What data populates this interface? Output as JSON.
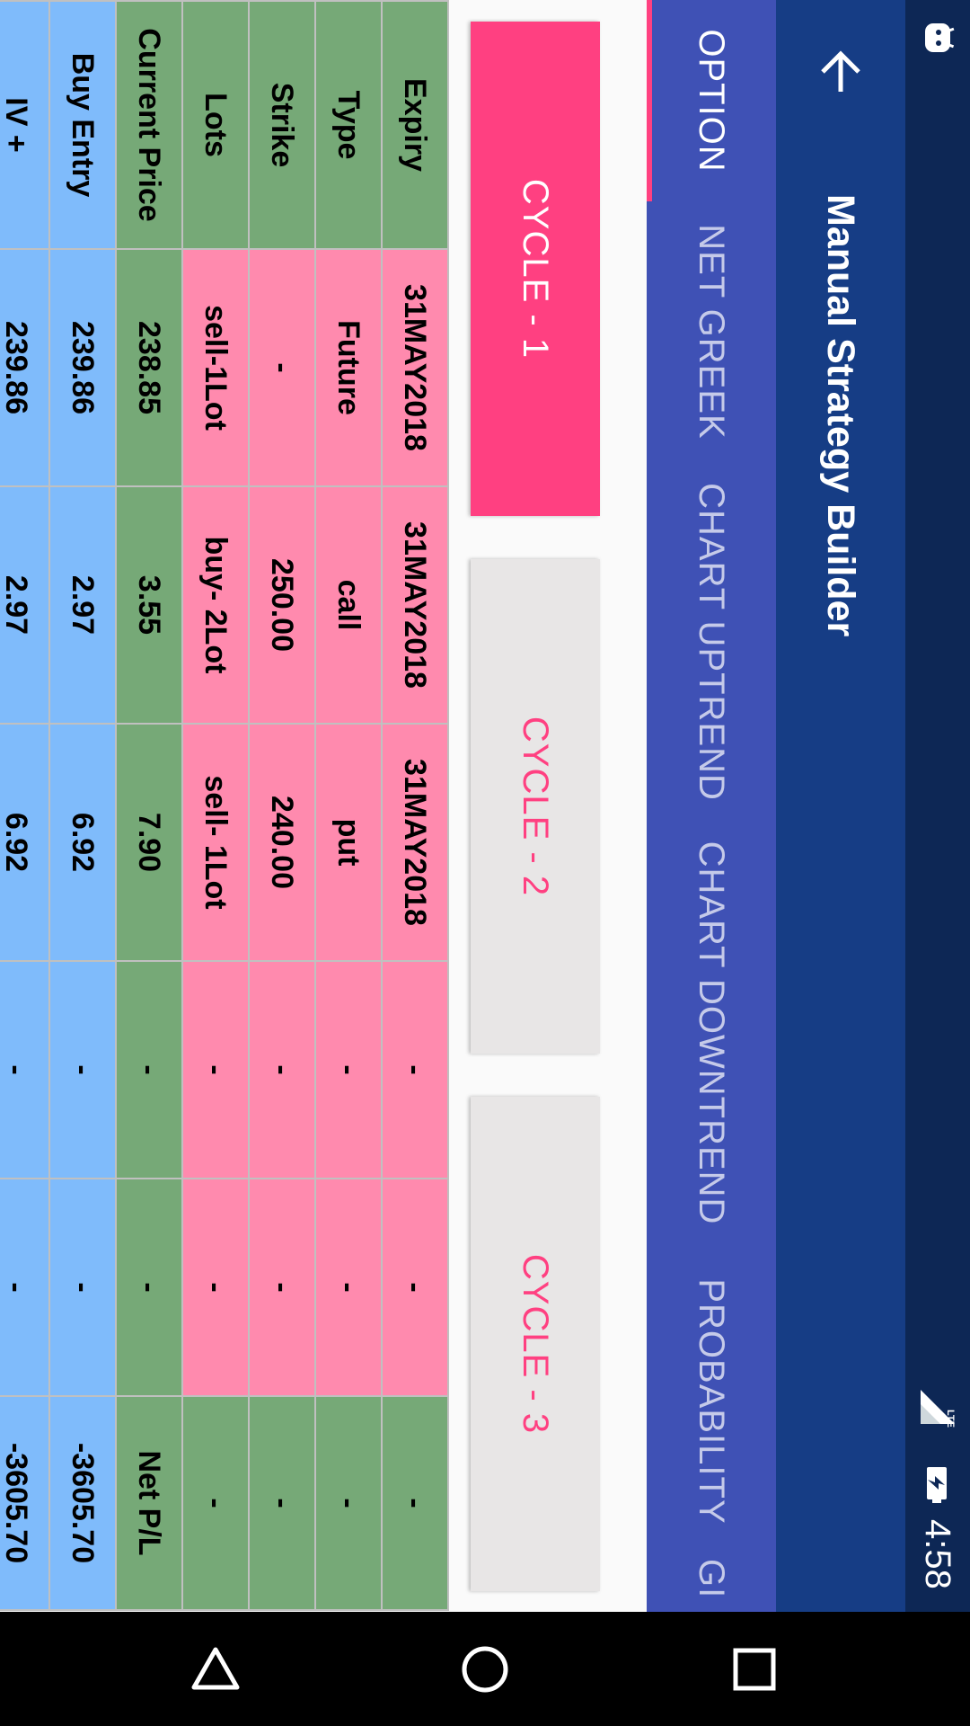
{
  "status_bar": {
    "time": "4:58",
    "network": "LTE"
  },
  "toolbar": {
    "title": "Manual Strategy Builder"
  },
  "tabs": [
    {
      "label": "OPTION",
      "active": true
    },
    {
      "label": "NET GREEK",
      "active": false
    },
    {
      "label": "CHART UPTREND",
      "active": false
    },
    {
      "label": "CHART DOWNTREND",
      "active": false
    },
    {
      "label": "PROBABILITY",
      "active": false
    },
    {
      "label": "GI",
      "active": false
    }
  ],
  "cycles": [
    {
      "label": "CYCLE - 1",
      "selected": true
    },
    {
      "label": "CYCLE - 2",
      "selected": false
    },
    {
      "label": "CYCLE - 3",
      "selected": false
    }
  ],
  "table": {
    "rows": [
      {
        "label": "Expiry",
        "cells": [
          "31MAY2018",
          "31MAY2018",
          "31MAY2018",
          "-",
          "-",
          "-"
        ]
      },
      {
        "label": "Type",
        "cells": [
          "Future",
          "call",
          "put",
          "-",
          "-",
          "-"
        ]
      },
      {
        "label": "Strike",
        "cells": [
          "-",
          "250.00",
          "240.00",
          "-",
          "-",
          "-"
        ]
      },
      {
        "label": "Lots",
        "cells": [
          "sell-1Lot",
          "buy- 2Lot",
          "sell- 1Lot",
          "-",
          "-",
          "-"
        ]
      },
      {
        "label": "Current Price",
        "cells": [
          "238.85",
          "3.55",
          "7.90",
          "-",
          "-",
          "Net P/L"
        ]
      },
      {
        "label": "Buy Entry",
        "cells": [
          "239.86",
          "2.97",
          "6.92",
          "-",
          "-",
          "-3605.70"
        ]
      },
      {
        "label": "IV +",
        "cells": [
          "239.86",
          "2.97",
          "6.92",
          "-",
          "-",
          "-3605.70"
        ]
      }
    ]
  },
  "colors": {
    "status_bar": "#0d2755",
    "toolbar": "#163d85",
    "tab_bar": "#3f51b5",
    "accent": "#ff4081",
    "row_green": "#76a977",
    "row_pink": "#ff8aae",
    "row_blue": "#7fbbfb"
  },
  "icons": {
    "back": "arrow-left-icon",
    "notification": "android-icon",
    "signal": "signal-icon",
    "battery": "battery-charging-icon",
    "nav_back": "triangle-back-icon",
    "nav_home": "circle-home-icon",
    "nav_recents": "square-recents-icon"
  }
}
